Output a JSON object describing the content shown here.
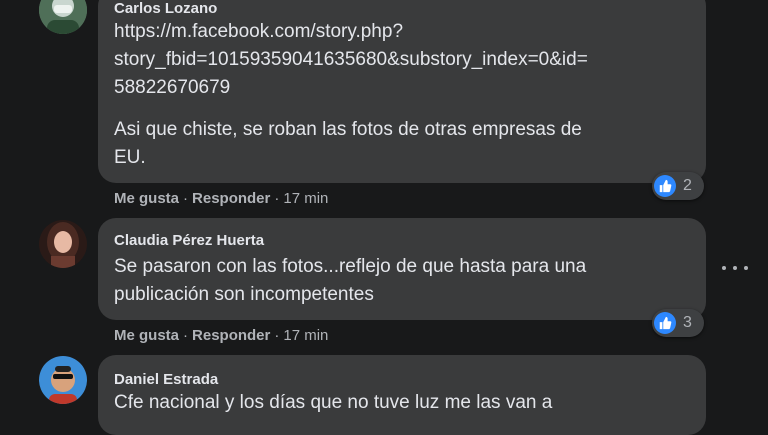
{
  "comments": [
    {
      "author": "Carlos Lozano",
      "text_lines": [
        "https://m.facebook.com/story.php?",
        "story_fbid=10159359041635680&substory_index=0&id=",
        "58822670679"
      ],
      "text2_lines": [
        "Asi que chiste, se roban las fotos de otras empresas de",
        "EU."
      ],
      "like": "Me gusta",
      "sep": "·",
      "reply": "Responder",
      "time": "17 min",
      "reactions": "2"
    },
    {
      "author": "Claudia Pérez Huerta",
      "text_lines": [
        "Se pasaron con las fotos...reflejo de que hasta para una",
        "publicación son incompetentes"
      ],
      "like": "Me gusta",
      "sep": "·",
      "reply": "Responder",
      "time": "17 min",
      "reactions": "3"
    },
    {
      "author": "Daniel Estrada",
      "text_lines": [
        "Cfe nacional y los días que no tuve luz me las van a"
      ]
    }
  ],
  "icons": {
    "reaction": "like-icon",
    "more": "more-options-icon"
  },
  "colors": {
    "background": "#18191a",
    "bubble": "#3a3b3c",
    "like_blue": "#2d88ff"
  }
}
